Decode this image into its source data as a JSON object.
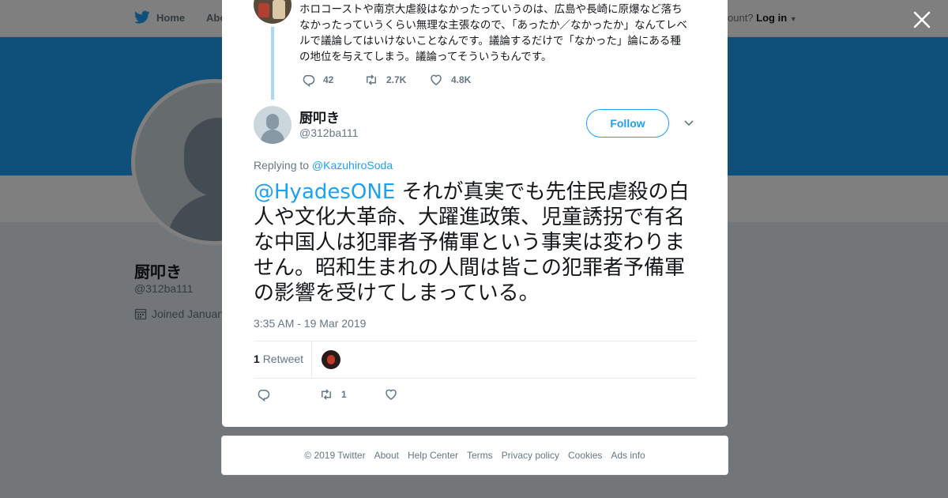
{
  "nav": {
    "home_label": "Home",
    "about_label": "Abo",
    "account_prompt": "ccount?",
    "login_label": "Log in"
  },
  "background_profile": {
    "name": "厨叩き",
    "handle": "@312ba111",
    "joined": "Joined January"
  },
  "parent_tweet": {
    "text": "ホロコーストや南京大虐殺はなかったっていうのは、広島や長崎に原爆など落ちなかったっていうくらい無理な主張なので、「あったか／なかったか」なんてレベルで議論してはいけないことなんです。議論するだけで「なかった」論にある種の地位を与えてしまう。議論ってそういうもんです。",
    "reply_count": "42",
    "retweet_count": "2.7K",
    "like_count": "4.8K"
  },
  "tweet": {
    "author_name": "厨叩き",
    "author_handle": "@312ba111",
    "follow_label": "Follow",
    "replying_prefix": "Replying to",
    "replying_to": "@KazuhiroSoda",
    "mention": "@HyadesONE",
    "text": " それが真実でも先住民虐殺の白人や文化大革命、大躍進政策、児童誘拐で有名な中国人は犯罪者予備軍という事実は変わりません。昭和生まれの人間は皆この犯罪者予備軍の影響を受けてしまっている。",
    "timestamp": "3:35 AM - 19 Mar 2019",
    "retweet_stat_count": "1",
    "retweet_stat_label": "Retweet",
    "retweet_count": "1"
  },
  "footer": {
    "copyright": "© 2019 Twitter",
    "links": [
      "About",
      "Help Center",
      "Terms",
      "Privacy policy",
      "Cookies",
      "Ads info"
    ]
  },
  "colors": {
    "accent": "#1da1f2",
    "text": "#14171a",
    "muted": "#657786",
    "thread_line": "#a8d8f5"
  },
  "icons": [
    "twitter-bird-icon",
    "close-icon",
    "reply-icon",
    "retweet-icon",
    "like-icon",
    "chevron-down-icon",
    "calendar-icon"
  ]
}
